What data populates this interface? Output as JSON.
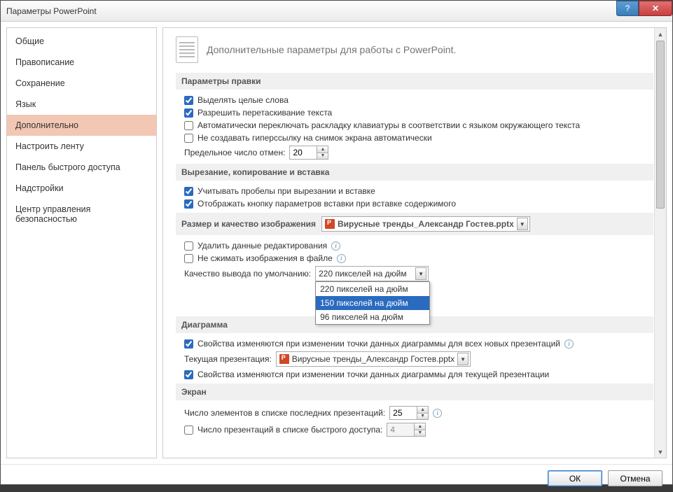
{
  "title": "Параметры PowerPoint",
  "sidebar": {
    "items": [
      {
        "label": "Общие"
      },
      {
        "label": "Правописание"
      },
      {
        "label": "Сохранение"
      },
      {
        "label": "Язык"
      },
      {
        "label": "Дополнительно"
      },
      {
        "label": "Настроить ленту"
      },
      {
        "label": "Панель быстрого доступа"
      },
      {
        "label": "Надстройки"
      },
      {
        "label": "Центр управления безопасностью"
      }
    ]
  },
  "page": {
    "heading": "Дополнительные параметры для работы с PowerPoint."
  },
  "sections": {
    "edit": {
      "title": "Параметры правки",
      "whole_words": "Выделять целые слова",
      "drag_drop": "Разрешить перетаскивание текста",
      "keyboard": "Автоматически переключать раскладку клавиатуры в соответствии с языком окружающего текста",
      "no_hyperlink": "Не создавать гиперссылку на снимок экрана автоматически",
      "undo_label": "Предельное число отмен:",
      "undo_value": "20"
    },
    "clipboard": {
      "title": "Вырезание, копирование и вставка",
      "spaces": "Учитывать пробелы при вырезании и вставке",
      "paste_btn": "Отображать кнопку параметров вставки при вставке содержимого"
    },
    "image": {
      "title": "Размер и качество изображения",
      "doc": "Вирусные тренды_Александр Гостев.pptx",
      "discard": "Удалить данные редактирования",
      "no_compress": "Не сжимать изображения в файле",
      "quality_label": "Качество вывода по умолчанию:",
      "quality_value": "220 пикселей на дюйм",
      "options": [
        "220 пикселей на дюйм",
        "150 пикселей на дюйм",
        "96 пикселей на дюйм"
      ]
    },
    "chart": {
      "title": "Диаграмма",
      "all_new": "Свойства изменяются при изменении точки данных диаграммы для всех новых презентаций",
      "current_label": "Текущая презентация:",
      "current_doc": "Вирусные тренды_Александр Гостев.pptx",
      "current": "Свойства изменяются при изменении точки данных диаграммы для текущей презентации"
    },
    "screen": {
      "title": "Экран",
      "recent_label": "Число элементов в списке последних презентаций:",
      "recent_value": "25",
      "quick_label": "Число презентаций в списке быстрого доступа:",
      "quick_value": "4"
    }
  },
  "buttons": {
    "ok": "ОК",
    "cancel": "Отмена"
  }
}
